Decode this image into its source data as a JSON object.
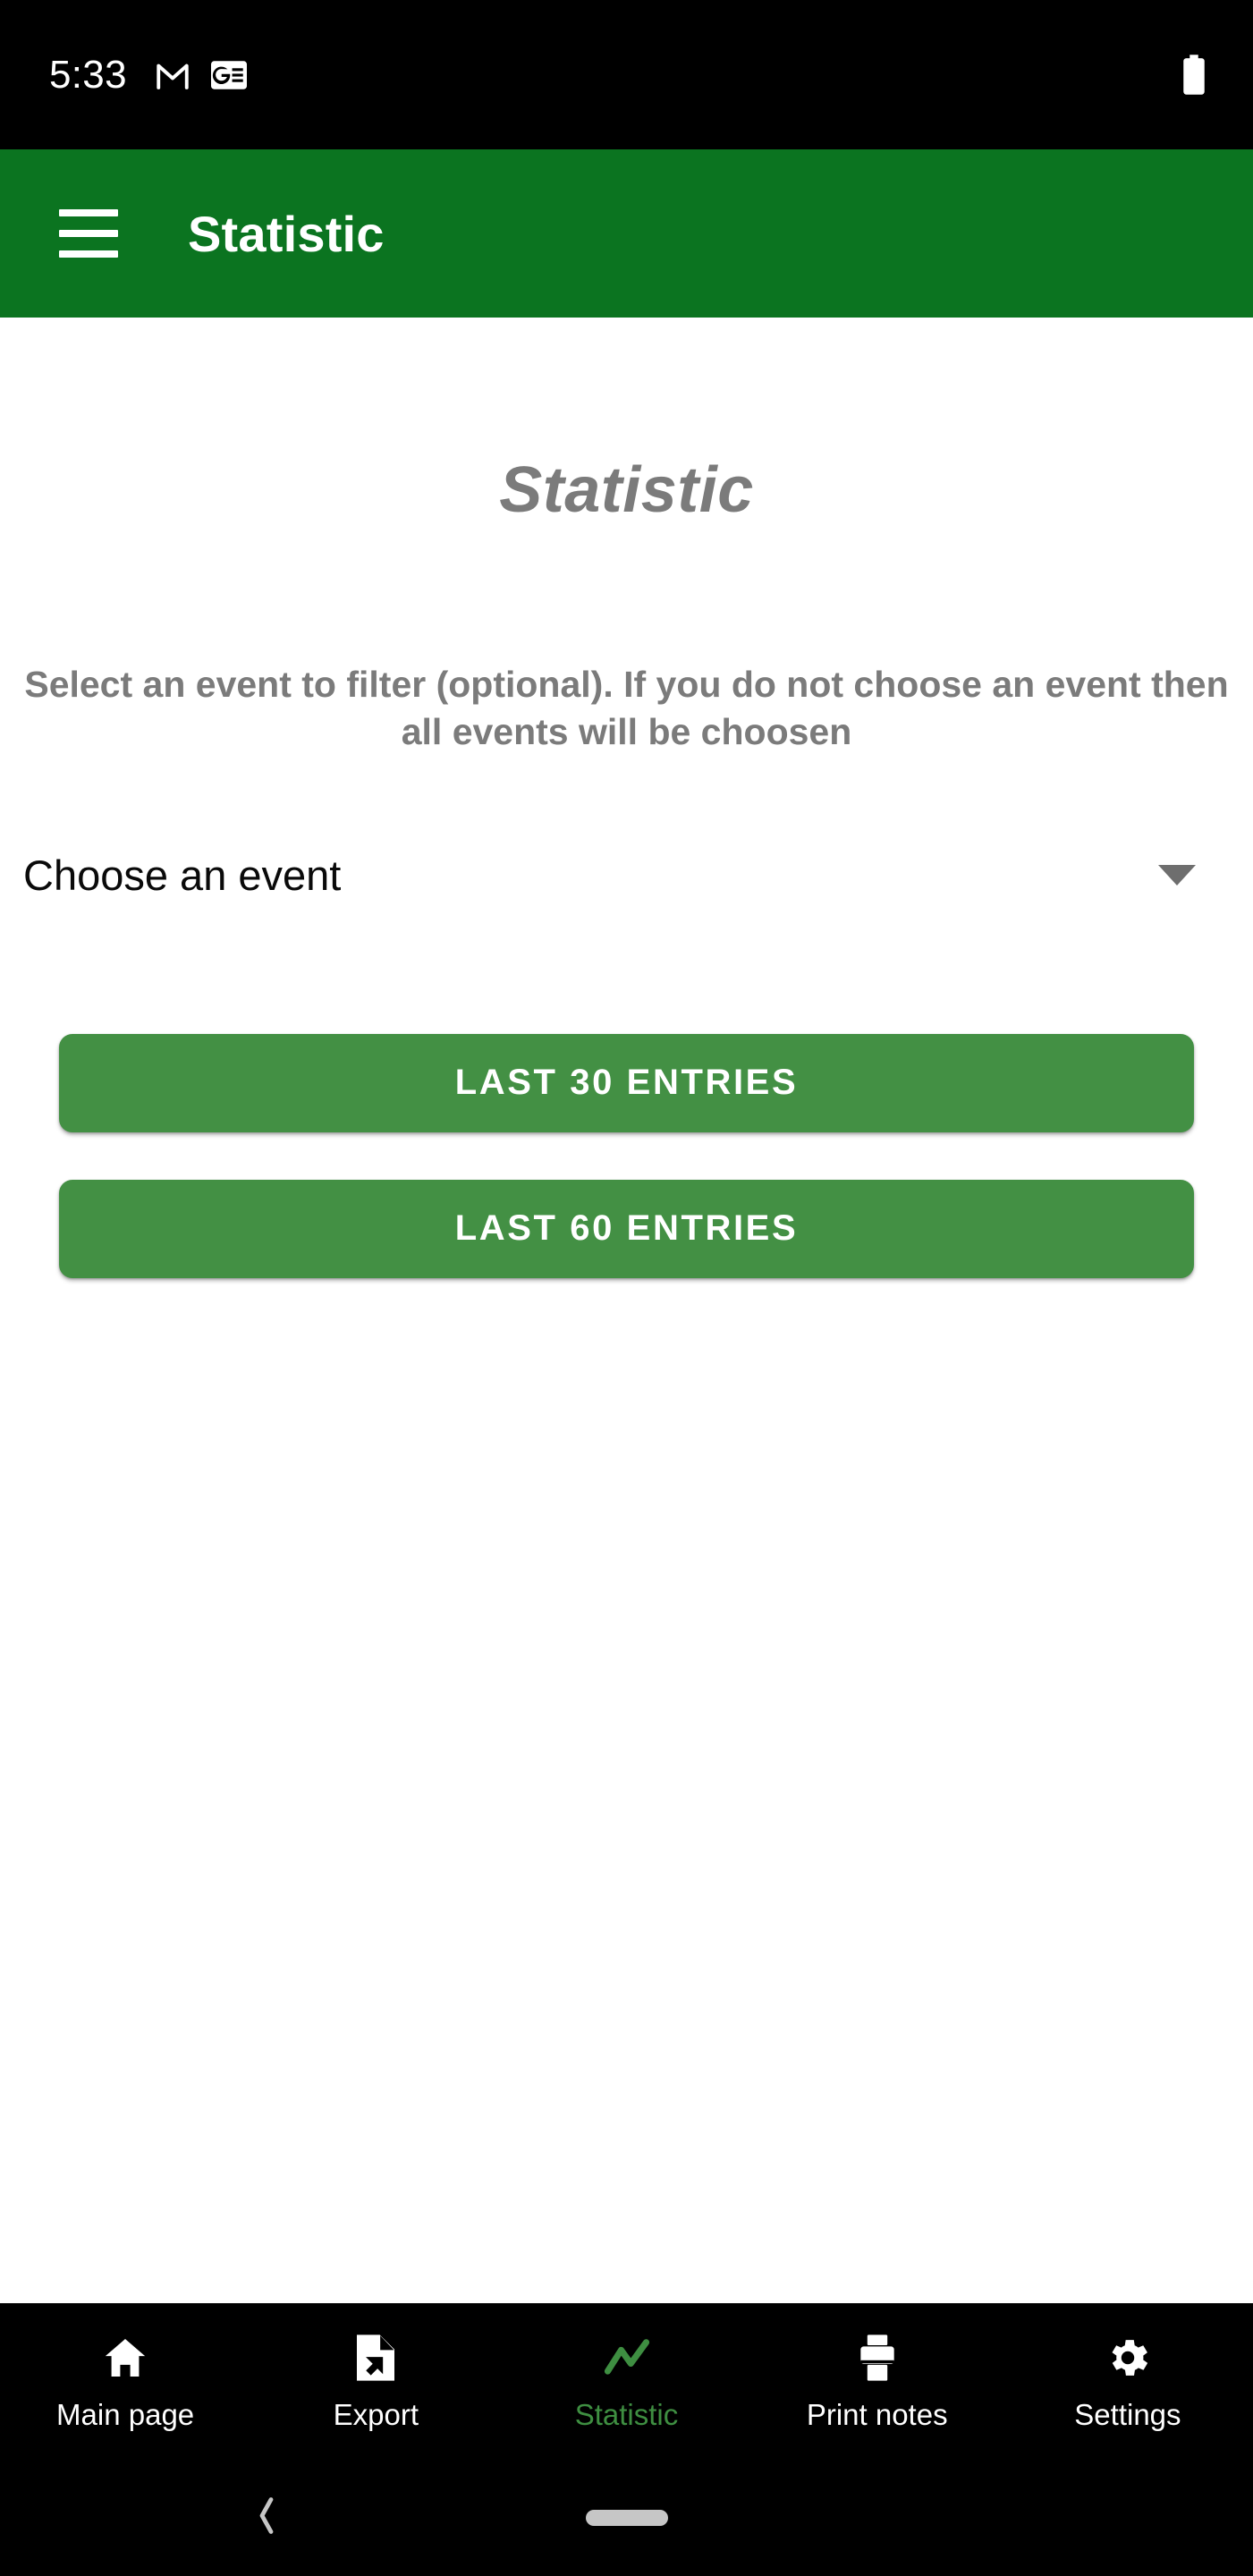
{
  "status_bar": {
    "time": "5:33",
    "icons": [
      {
        "name": "gmail-icon",
        "label": "Gmail"
      },
      {
        "name": "google-news-icon",
        "label": "Google News"
      }
    ],
    "battery": {
      "name": "battery-icon",
      "label": "Battery full"
    }
  },
  "app_bar": {
    "menu_icon": "hamburger-menu-icon",
    "title": "Statistic",
    "background_color": "#0B7420"
  },
  "main": {
    "heading": "Statistic",
    "hint": "Select an event to filter (optional). If you do not choose an event then all events will be choosen",
    "event_select": {
      "label": "Choose an event",
      "value": "Choose an event",
      "placeholder": "Choose an event",
      "chevron_icon": "chevron-down-icon"
    },
    "buttons": [
      {
        "label": "LAST 30 ENTRIES",
        "name": "last-30-entries-button"
      },
      {
        "label": "LAST 60 ENTRIES",
        "name": "last-60-entries-button"
      }
    ],
    "accent_color": "#439044",
    "heading_color": "#7b7b7b"
  },
  "bottom_nav": {
    "active_color": "#3E8E41",
    "inactive_color": "#FFFFFF",
    "items": [
      {
        "label": "Main page",
        "icon": "home-icon",
        "active": false
      },
      {
        "label": "Export",
        "icon": "file-export-icon",
        "active": false
      },
      {
        "label": "Statistic",
        "icon": "trend-line-icon",
        "active": true
      },
      {
        "label": "Print notes",
        "icon": "printer-icon",
        "active": false
      },
      {
        "label": "Settings",
        "icon": "gear-icon",
        "active": false
      }
    ]
  },
  "system_nav": {
    "back_icon": "back-chevron-icon",
    "home_pill": "home-pill-indicator"
  }
}
